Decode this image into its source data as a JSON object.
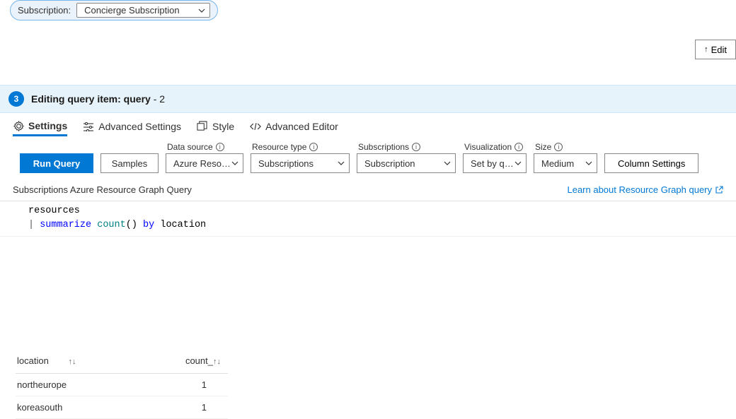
{
  "subscription": {
    "label": "Subscription:",
    "selected": "Concierge Subscription"
  },
  "edit_button": "Edit",
  "banner": {
    "step": "3",
    "prefix": "Editing query item: query",
    "suffix": " - 2"
  },
  "tabs": {
    "settings": "Settings",
    "advanced_settings": "Advanced Settings",
    "style": "Style",
    "advanced_editor": "Advanced Editor"
  },
  "buttons": {
    "run_query": "Run Query",
    "samples": "Samples",
    "column_settings": "Column Settings"
  },
  "labels": {
    "data_source": "Data source",
    "resource_type": "Resource type",
    "subscriptions": "Subscriptions",
    "visualization": "Visualization",
    "size": "Size"
  },
  "dropdowns": {
    "data_source": "Azure Reso…",
    "resource_type": "Subscriptions",
    "subscriptions": "Subscription",
    "visualization": "Set by q…",
    "size": "Medium"
  },
  "meta": {
    "query_title": "Subscriptions Azure Resource Graph Query",
    "learn_link": "Learn about Resource Graph query"
  },
  "code": {
    "line1": "resources",
    "line2_pipe": "| ",
    "line2_summarize": "summarize",
    "line2_count": " count",
    "line2_parens": "() ",
    "line2_by": "by",
    "line2_location": " location"
  },
  "table": {
    "columns": {
      "location": "location",
      "count": "count_"
    },
    "rows": [
      {
        "location": "northeurope",
        "count": "1"
      },
      {
        "location": "koreasouth",
        "count": "1"
      }
    ]
  }
}
